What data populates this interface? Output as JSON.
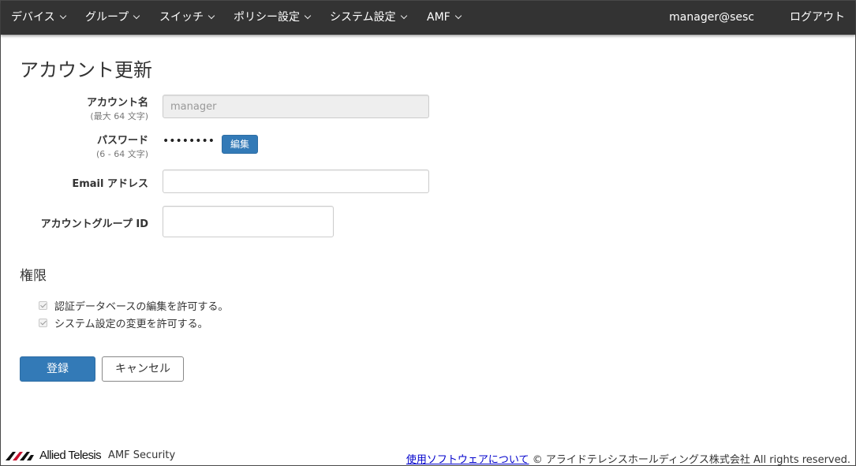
{
  "nav": {
    "items": [
      {
        "label": "デバイス"
      },
      {
        "label": "グループ"
      },
      {
        "label": "スイッチ"
      },
      {
        "label": "ポリシー設定"
      },
      {
        "label": "システム設定"
      },
      {
        "label": "AMF"
      }
    ],
    "user": "manager@sesc",
    "logout": "ログアウト"
  },
  "page": {
    "title": "アカウント更新"
  },
  "form": {
    "account_name": {
      "label": "アカウント名",
      "hint": "(最大 64 文字)",
      "value": "manager"
    },
    "password": {
      "label": "パスワード",
      "hint": "(6 - 64 文字)",
      "masked": "••••••••",
      "edit_label": "編集"
    },
    "email": {
      "label": "Email アドレス",
      "value": ""
    },
    "group_id": {
      "label": "アカウントグループ ID",
      "value": ""
    }
  },
  "permissions": {
    "title": "権限",
    "items": [
      {
        "label": "認証データベースの編集を許可する。",
        "checked": true
      },
      {
        "label": "システム設定の変更を許可する。",
        "checked": true
      }
    ]
  },
  "actions": {
    "submit": "登録",
    "cancel": "キャンセル"
  },
  "footer": {
    "brand": "Allied Telesis",
    "product": "AMF Security",
    "link": "使用ソフトウェアについて",
    "copyright": "© アライドテレシスホールディングス株式会社 All rights reserved."
  },
  "colors": {
    "navbar": "#333333",
    "primary": "#337ab7",
    "link": "#0000cc"
  }
}
